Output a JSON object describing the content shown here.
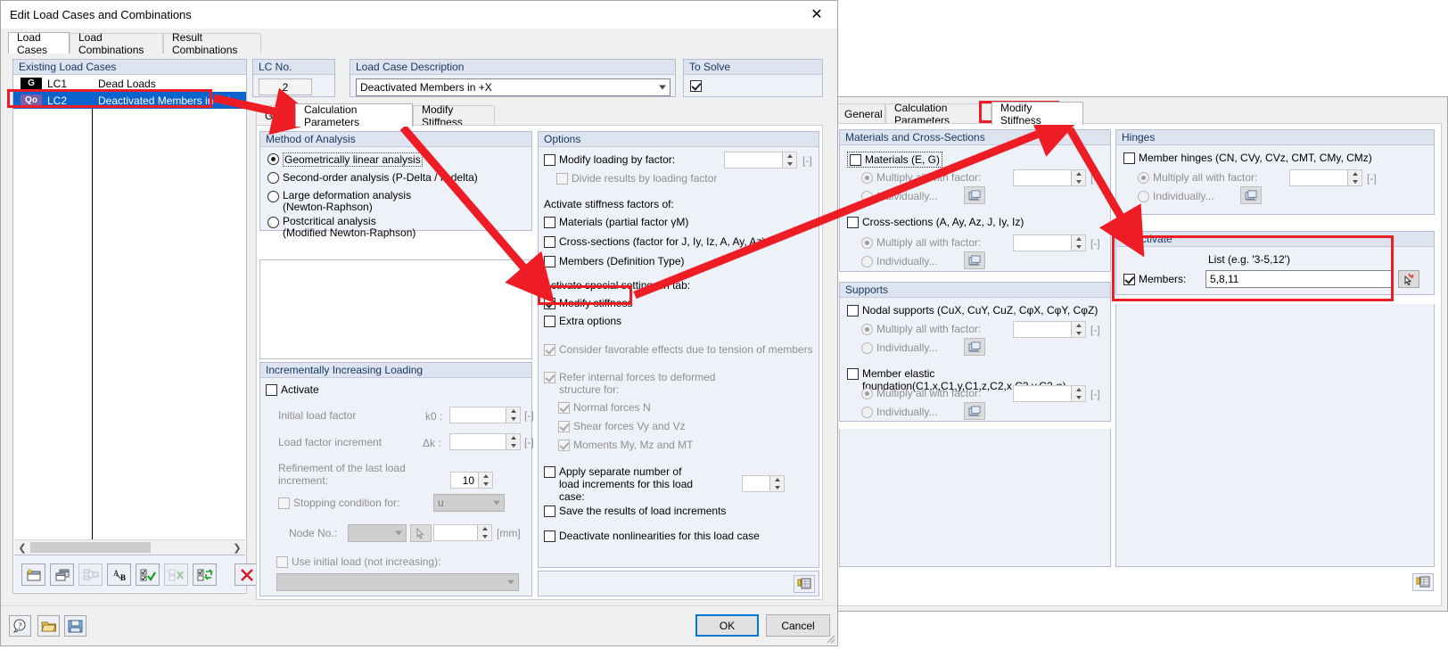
{
  "window": {
    "title": "Edit Load Cases and Combinations",
    "close_icon": "close-icon"
  },
  "tabs": [
    {
      "label": "Load Cases",
      "active": true
    },
    {
      "label": "Load Combinations",
      "active": false
    },
    {
      "label": "Result Combinations",
      "active": false
    }
  ],
  "existing_load_cases": {
    "header": "Existing Load Cases",
    "rows": [
      {
        "badge": "G",
        "badge_color": "#000000",
        "id": "LC1",
        "description": "Dead Loads",
        "selected": false
      },
      {
        "badge": "Qo",
        "badge_color": "#7b5ea7",
        "id": "LC2",
        "description": "Deactivated Members in +X",
        "selected": true
      }
    ]
  },
  "lc_no": {
    "header": "LC No.",
    "value": "2"
  },
  "lc_description": {
    "header": "Load Case Description",
    "value": "Deactivated Members in +X"
  },
  "to_solve": {
    "header": "To Solve",
    "checked": true
  },
  "inner_tabs_left": [
    {
      "label": "General",
      "active": false
    },
    {
      "label": "Calculation Parameters",
      "active": true
    },
    {
      "label": "Modify Stiffness",
      "active": false
    }
  ],
  "method_of_analysis": {
    "header": "Method of Analysis",
    "options": [
      {
        "label": "Geometrically linear analysis",
        "selected": true,
        "focused": true
      },
      {
        "label": "Second-order analysis (P-Delta / P-delta)",
        "selected": false
      },
      {
        "label": "Large deformation analysis\n(Newton-Raphson)",
        "selected": false
      },
      {
        "label": "Postcritical analysis\n(Modified Newton-Raphson)",
        "selected": false
      }
    ]
  },
  "incrementally_increasing_loading": {
    "header": "Incrementally Increasing Loading",
    "activate": {
      "label": "Activate",
      "checked": false
    },
    "initial_load_factor": {
      "label": "Initial load factor",
      "symbol": "k0",
      "value": "",
      "unit": "[-]"
    },
    "load_factor_increment": {
      "label": "Load factor increment",
      "symbol": "Δk",
      "value": "",
      "unit": "[-]"
    },
    "refinement": {
      "label": "Refinement of the last load increment:",
      "value": "10"
    },
    "stopping_condition": {
      "label": "Stopping condition for:",
      "checked": false,
      "value": "u"
    },
    "node_no": {
      "label": "Node No.:",
      "value": "",
      "field_value": "",
      "unit": "[mm]",
      "pick_icon": "pick-cursor-icon"
    },
    "use_initial_load": {
      "label": "Use initial load (not increasing):",
      "checked": false,
      "value": ""
    }
  },
  "options": {
    "header": "Options",
    "modify_loading_by_factor": {
      "label": "Modify loading by factor:",
      "checked": false,
      "value": "",
      "unit": "[-]"
    },
    "divide_results": {
      "label": "Divide results by loading factor",
      "checked": false,
      "disabled": true
    },
    "activate_stiffness_label": "Activate stiffness factors of:",
    "stiffness_items": [
      {
        "label": "Materials (partial factor γM)",
        "checked": false
      },
      {
        "label": "Cross-sections (factor for J, Iy, Iz, A, Ay, Az)",
        "checked": false
      },
      {
        "label": "Members (Definition Type)",
        "checked": false
      }
    ],
    "activate_special_label": "Activate special settings in tab:",
    "special_items": [
      {
        "label": "Modify stiffness",
        "checked": true,
        "highlighted": true
      },
      {
        "label": "Extra options",
        "checked": false
      }
    ],
    "consider_favorable": {
      "label": "Consider favorable effects due to tension of members",
      "checked": true,
      "disabled": true
    },
    "refer_internal": {
      "label": "Refer internal forces to deformed structure for:",
      "checked": true,
      "disabled": true
    },
    "refer_sub_items": [
      {
        "label": "Normal forces N",
        "checked": true,
        "disabled": true
      },
      {
        "label": "Shear forces Vy and Vz",
        "checked": true,
        "disabled": true
      },
      {
        "label": "Moments My, Mz and MT",
        "checked": true,
        "disabled": true
      }
    ],
    "apply_separate": {
      "label": "Apply separate number of load increments for this load case:",
      "checked": false,
      "value": ""
    },
    "save_results": {
      "label": "Save the results of load increments",
      "checked": false
    },
    "deactivate_nonlinearities": {
      "label": "Deactivate nonlinearities for this load case",
      "checked": false
    },
    "settings_icon": "settings-table-icon"
  },
  "inner_tabs_right": [
    {
      "label": "General",
      "active": false
    },
    {
      "label": "Calculation Parameters",
      "active": false
    },
    {
      "label": "Modify Stiffness",
      "active": true
    }
  ],
  "materials_cross_sections": {
    "header": "Materials and Cross-Sections",
    "materials": {
      "label": "Materials (E, G)",
      "checked": false,
      "focused": true,
      "multiply": {
        "label": "Multiply all with factor:",
        "selected": true,
        "disabled": true,
        "value": "",
        "unit": "[-]"
      },
      "individually": {
        "label": "Individually...",
        "selected": false,
        "disabled": true,
        "icon": "table-edit-icon"
      }
    },
    "cross_sections": {
      "label": "Cross-sections (A, Ay, Az, J, Iy, Iz)",
      "checked": false,
      "multiply": {
        "label": "Multiply all with factor:",
        "selected": true,
        "disabled": true,
        "value": "",
        "unit": "[-]"
      },
      "individually": {
        "label": "Individually...",
        "selected": false,
        "disabled": true,
        "icon": "table-edit-icon"
      }
    }
  },
  "supports": {
    "header": "Supports",
    "nodal": {
      "label": "Nodal supports (CuX, CuY, CuZ, CφX, CφY, CφZ)",
      "checked": false,
      "multiply": {
        "label": "Multiply all with factor:",
        "selected": true,
        "disabled": true,
        "value": "",
        "unit": "[-]"
      },
      "individually": {
        "label": "Individually...",
        "selected": false,
        "disabled": true,
        "icon": "table-edit-icon"
      }
    },
    "member_elastic": {
      "label": "Member elastic foundation(C1,x,C1,y,C1,z,C2,x,C2,y,C2,φ)",
      "checked": false,
      "multiply": {
        "label": "Multiply all with factor:",
        "selected": true,
        "disabled": true,
        "value": "",
        "unit": "[-]"
      },
      "individually": {
        "label": "Individually...",
        "selected": false,
        "disabled": true,
        "icon": "table-edit-icon"
      }
    }
  },
  "hinges": {
    "header": "Hinges",
    "member_hinges": {
      "label": "Member hinges (CN, CVy, CVz, CMT, CMy, CMz)",
      "checked": false,
      "multiply": {
        "label": "Multiply all with factor:",
        "selected": true,
        "disabled": true,
        "value": "",
        "unit": "[-]"
      },
      "individually": {
        "label": "Individually...",
        "selected": false,
        "disabled": true,
        "icon": "table-edit-icon"
      }
    }
  },
  "deactivate": {
    "header": "Deactivate",
    "list_hint": "List (e.g. '3-5,12')",
    "members": {
      "label": "Members:",
      "checked": true,
      "value": "5,8,11"
    },
    "pick_icon": "pick-members-icon",
    "highlighted": true
  },
  "right_panel_settings_icon": "settings-table-icon",
  "list_toolbar": [
    {
      "name": "new-load-case-icon",
      "enabled": true
    },
    {
      "name": "copy-load-case-icon",
      "enabled": true
    },
    {
      "name": "reorder-icon",
      "enabled": false
    },
    {
      "name": "rename-icon",
      "enabled": true
    },
    {
      "name": "select-all-icon",
      "enabled": true
    },
    {
      "name": "deselect-all-icon",
      "enabled": false
    },
    {
      "name": "invert-selection-icon",
      "enabled": true
    },
    {
      "name": "delete-icon",
      "enabled": true
    }
  ],
  "bottom_toolbar": [
    {
      "name": "help-icon"
    },
    {
      "name": "open-folder-icon"
    },
    {
      "name": "save-icon"
    }
  ],
  "buttons": {
    "ok": "OK",
    "cancel": "Cancel"
  },
  "annotations": {
    "accent_color": "#ee1c25",
    "highlights": [
      "load-case-row-lc2",
      "calculation-parameters-tab",
      "modify-stiffness-checkbox",
      "modify-stiffness-tab",
      "deactivate-group"
    ]
  }
}
